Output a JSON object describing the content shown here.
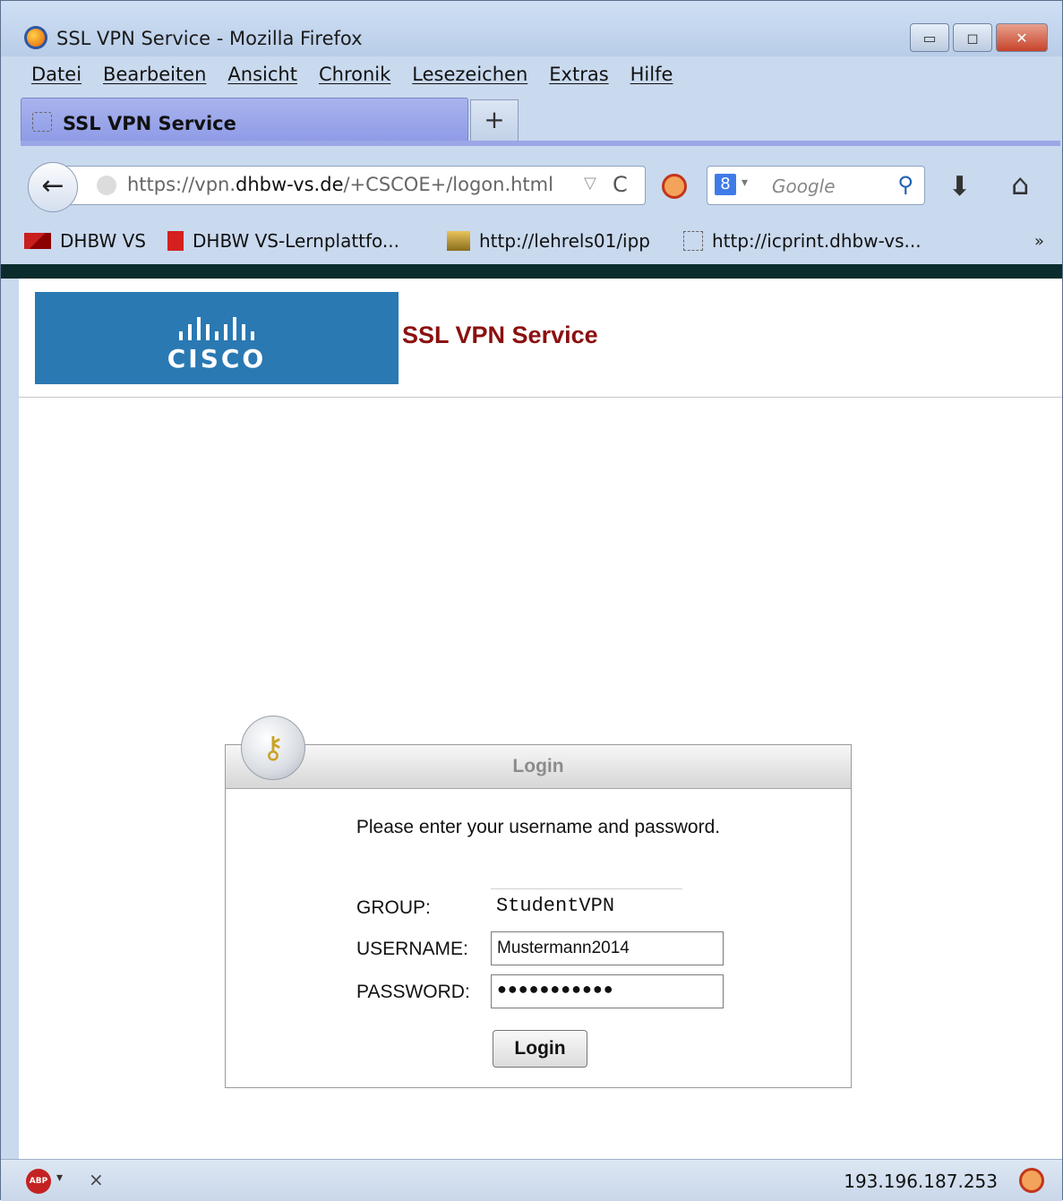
{
  "window": {
    "title": "SSL VPN Service - Mozilla Firefox",
    "controls": {
      "minimize": "▭",
      "maximize": "◻",
      "close": "✕"
    }
  },
  "menubar": {
    "items": [
      "Datei",
      "Bearbeiten",
      "Ansicht",
      "Chronik",
      "Lesezeichen",
      "Extras",
      "Hilfe"
    ]
  },
  "tabs": {
    "active_label": "SSL VPN Service",
    "new_tab": "+"
  },
  "navbar": {
    "url_prefix": "https://vpn.",
    "url_domain": "dhbw-vs.de",
    "url_path": "/+CSCOE+/logon.html",
    "search_engine_icon": "8",
    "search_placeholder": "Google",
    "back_icon": "←",
    "reload_icon": "C",
    "dropdown_icon": "▽",
    "download_icon": "⬇",
    "home_icon": "⌂",
    "search_icon": "⚲"
  },
  "bookmarks": {
    "items": [
      {
        "label": "DHBW VS",
        "icon": "dhbw-logo-icon"
      },
      {
        "label": "DHBW VS-Lernplattfo...",
        "icon": "moodle-icon"
      },
      {
        "label": "http://lehrels01/ipp",
        "icon": "printer-icon"
      },
      {
        "label": "http://icprint.dhbw-vs...",
        "icon": "page-icon"
      }
    ],
    "more": "»"
  },
  "page": {
    "logo_text": "CISCO",
    "service_title": "SSL VPN Service",
    "login": {
      "header": "Login",
      "prompt": "Please enter your username and password.",
      "group_label": "GROUP:",
      "group_value": "StudentVPN",
      "username_label": "USERNAME:",
      "username_value": "Mustermann2014",
      "password_label": "PASSWORD:",
      "password_mask": "●●●●●●●●●●●",
      "button": "Login"
    }
  },
  "statusbar": {
    "abp_label": "ABP",
    "ip": "193.196.187.253",
    "close": "×"
  }
}
